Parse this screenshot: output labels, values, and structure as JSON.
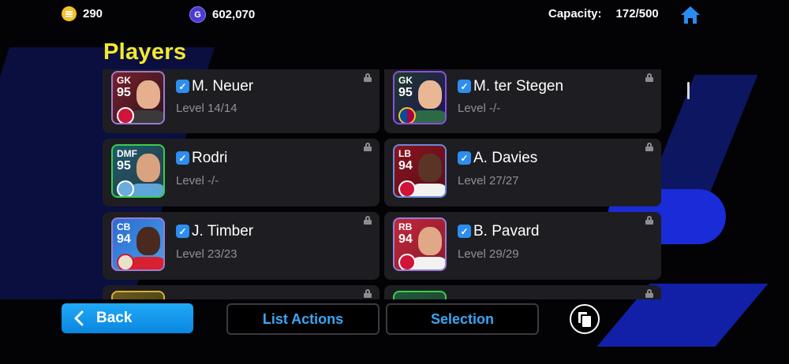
{
  "topbar": {
    "coins": {
      "icon": "e-coin-icon",
      "value": "290"
    },
    "gp": {
      "icon": "g-point-icon",
      "value": "602,070"
    },
    "capacity_label": "Capacity:",
    "capacity_value": "172/500",
    "home_icon": "home-icon"
  },
  "page": {
    "title": "Players"
  },
  "players": [
    {
      "position": "GK",
      "rating": "95",
      "name": "M. Neuer",
      "level": "Level 14/14",
      "locked": true,
      "selected": true
    },
    {
      "position": "GK",
      "rating": "95",
      "name": "M. ter Stegen",
      "level": "Level -/-",
      "locked": true,
      "selected": true
    },
    {
      "position": "DMF",
      "rating": "95",
      "name": "Rodri",
      "level": "Level -/-",
      "locked": true,
      "selected": true
    },
    {
      "position": "LB",
      "rating": "94",
      "name": "A. Davies",
      "level": "Level 27/27",
      "locked": true,
      "selected": true
    },
    {
      "position": "CB",
      "rating": "94",
      "name": "J. Timber",
      "level": "Level 23/23",
      "locked": true,
      "selected": true
    },
    {
      "position": "RB",
      "rating": "94",
      "name": "B. Pavard",
      "level": "Level 29/29",
      "locked": true,
      "selected": true
    }
  ],
  "actions": {
    "back": "Back",
    "list_actions": "List Actions",
    "selection": "Selection"
  },
  "colors": {
    "accent_yellow": "#f4ea2a",
    "accent_blue": "#3aa6f5",
    "back_button": "#0a86e0",
    "card_bg": "#1e1e22"
  }
}
